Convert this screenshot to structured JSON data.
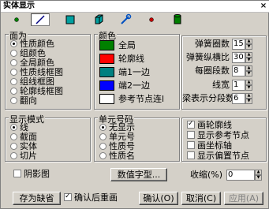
{
  "window": {
    "title": "实体显示",
    "close": "×"
  },
  "toolbar": {
    "icons": [
      "dot-green-icon",
      "line-icon",
      "square-icon",
      "cube-icon",
      "wrench-icon",
      "dot-red-icon",
      "cylinder-icon"
    ]
  },
  "face_group": {
    "title": "面为",
    "options": [
      "性质颜色",
      "组颜色",
      "全局颜色",
      "性质线框图",
      "组线框图",
      "轮廓线框图",
      "翻向"
    ],
    "selected": 0
  },
  "color_group": {
    "title": "颜色",
    "items": [
      {
        "label": "全局",
        "color": "#008000"
      },
      {
        "label": "轮廓线",
        "color": "#ff0000"
      },
      {
        "label": "端1一边",
        "color": "#008080"
      },
      {
        "label": "端2一边",
        "color": "#0000ff"
      },
      {
        "label": "参考节点连l",
        "color": "#ffffff"
      }
    ]
  },
  "spring_params": [
    {
      "label": "弹簧圈数",
      "value": "15"
    },
    {
      "label": "弹簧纵横比",
      "value": "30"
    },
    {
      "label": "每圈段数",
      "value": "8"
    },
    {
      "label": "线宽",
      "value": "1"
    },
    {
      "label": "梁表示分段数",
      "value": "6"
    }
  ],
  "display_mode": {
    "title": "显示模式",
    "options": [
      "线",
      "截面",
      "实体",
      "切片"
    ],
    "selected": 0
  },
  "element_no": {
    "title": "单元号码",
    "options": [
      "无显示",
      "单元号",
      "性质号",
      "性质名"
    ],
    "selected": 0
  },
  "display_checks": [
    {
      "label": "画轮廓线",
      "checked": true
    },
    {
      "label": "显示参考节点",
      "checked": false
    },
    {
      "label": "画坐标轴",
      "checked": false
    },
    {
      "label": "显示偏置节点",
      "checked": false
    }
  ],
  "shadow_check": {
    "label": "阴影图",
    "checked": false
  },
  "value_font_button": "数值字型...",
  "shrink": {
    "label": "收缩(%)",
    "value": "0"
  },
  "bottom": {
    "save_default": "存为缺省",
    "redraw_check": {
      "label": "确认后重画",
      "checked": true
    },
    "ok": "确认(O)",
    "cancel": "取消(C)",
    "apply": "应用(A)"
  }
}
